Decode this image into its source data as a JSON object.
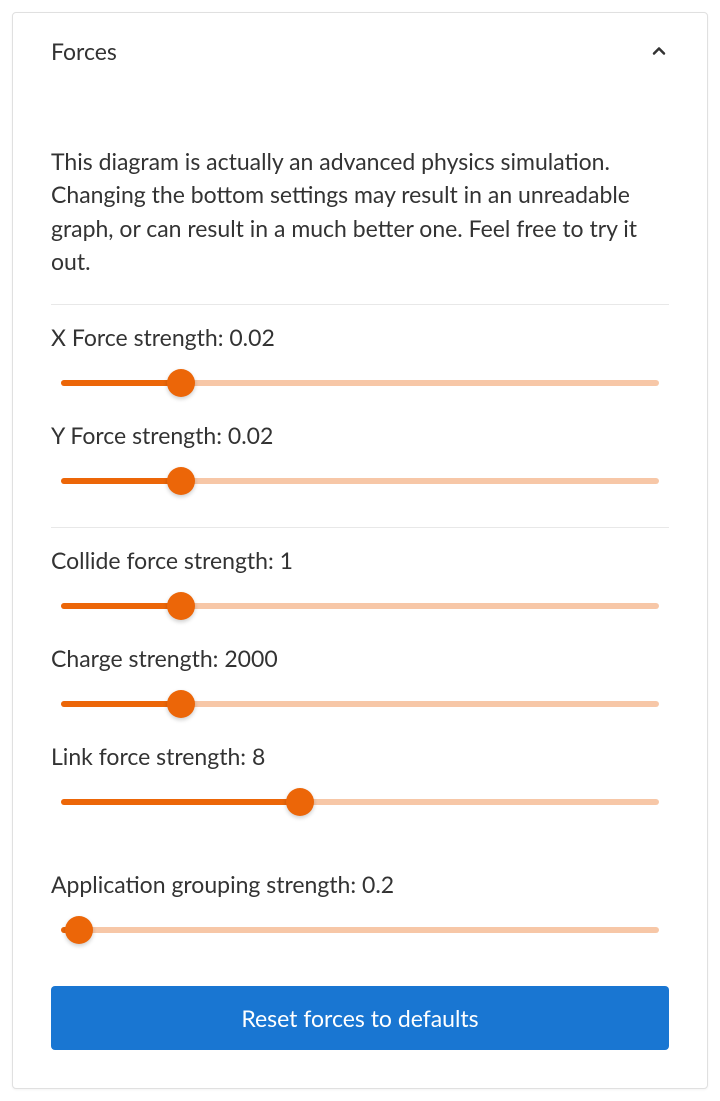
{
  "panel": {
    "title": "Forces",
    "description": "This diagram is actually an advanced physics simulation. Changing the bottom settings may result in an unreadable graph, or can result in a much better one. Feel free to try it out.",
    "reset_label": "Reset forces to defaults"
  },
  "sliders": {
    "x_force": {
      "label": "X Force strength: ",
      "value": "0.02",
      "percent": 20
    },
    "y_force": {
      "label": "Y Force strength: ",
      "value": "0.02",
      "percent": 20
    },
    "collide_force": {
      "label": "Collide force strength: ",
      "value": "1",
      "percent": 20
    },
    "charge": {
      "label": "Charge strength: ",
      "value": "2000",
      "percent": 20
    },
    "link_force": {
      "label": "Link force strength: ",
      "value": "8",
      "percent": 40
    },
    "app_grouping": {
      "label": "Application grouping strength: ",
      "value": "0.2",
      "percent": 3
    }
  }
}
